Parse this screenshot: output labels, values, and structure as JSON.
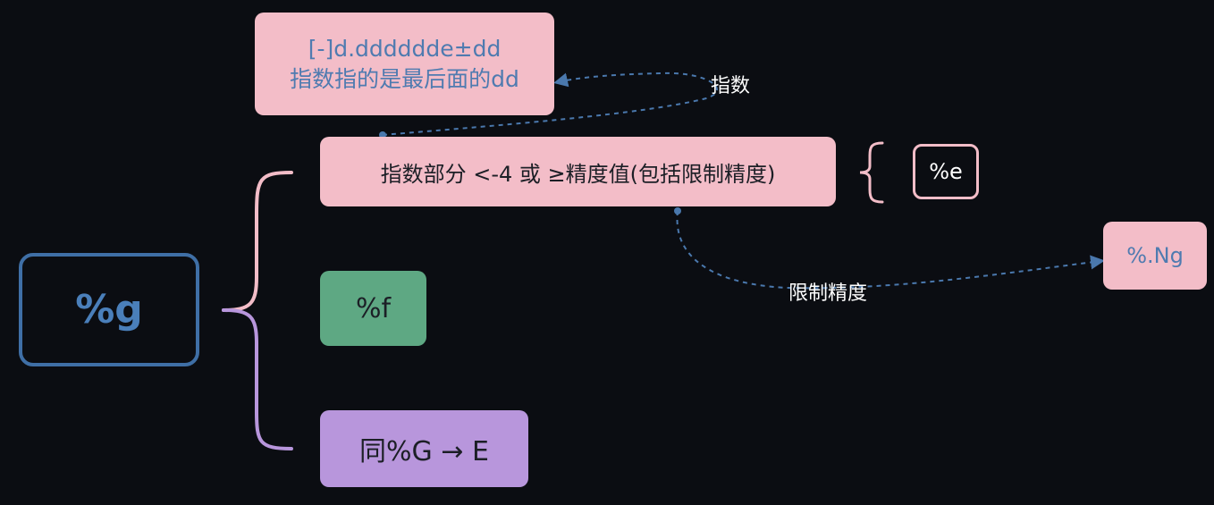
{
  "nodes": {
    "root": "%g",
    "exponent_condition": "指数部分 <-4 或 ≥精度值(包括限制精度)",
    "format_line1": "[-]d.dddddde±dd",
    "format_line2": "指数指的是最后面的dd",
    "f_format": "%f",
    "G_format": "同%G → E",
    "e_format": "%e",
    "ng_format": "%.Ng"
  },
  "edge_labels": {
    "exponent": "指数",
    "precision": "限制精度"
  },
  "colors": {
    "background": "#0b0d12",
    "pink": "#f3bdc8",
    "green": "#5ea883",
    "purple": "#b896dc",
    "blue": "#3f6fa6",
    "dash": "#4a78ad"
  }
}
